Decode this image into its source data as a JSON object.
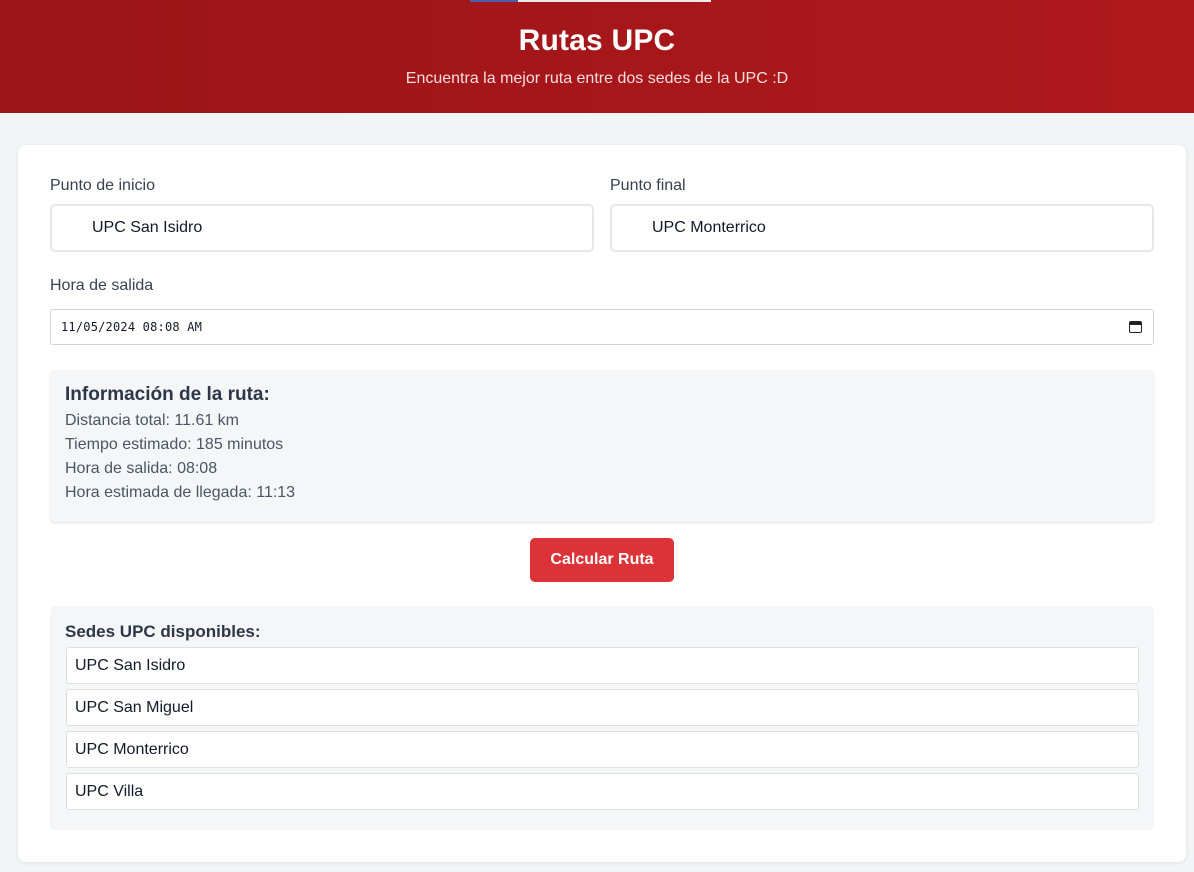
{
  "header": {
    "title": "Rutas UPC",
    "subtitle": "Encuentra la mejor ruta entre dos sedes de la UPC :D"
  },
  "form": {
    "start_label": "Punto de inicio",
    "start_value": "UPC San Isidro",
    "end_label": "Punto final",
    "end_value": "UPC Monterrico",
    "time_label": "Hora de salida",
    "time_value": "11/05/2024 08:08 AM"
  },
  "route_info": {
    "title": "Información de la ruta:",
    "distance": "Distancia total: 11.61 km",
    "estimated_time": "Tiempo estimado: 185 minutos",
    "departure": "Hora de salida: 08:08",
    "arrival": "Hora estimada de llegada: 11:13"
  },
  "actions": {
    "calculate_label": "Calcular Ruta"
  },
  "sedes": {
    "title": "Sedes UPC disponibles:",
    "items": [
      "UPC San Isidro",
      "UPC San Miguel",
      "UPC Monterrico",
      "UPC Villa"
    ]
  },
  "colors": {
    "header_bg": "#a7171a",
    "accent_button": "#dc3338",
    "page_bg": "#f3f4f6"
  }
}
